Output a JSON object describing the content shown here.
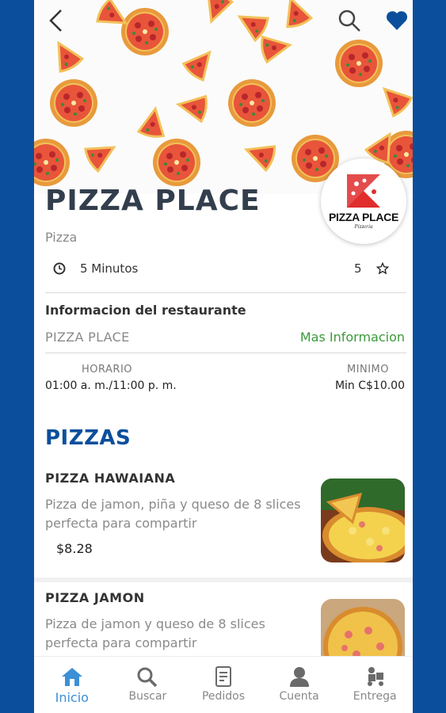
{
  "restaurant": {
    "name": "PIZZA PLACE",
    "category": "Pizza",
    "delivery_time": "5 Minutos",
    "rating": "5",
    "logo_text": "PIZZA PLACE",
    "logo_tagline": "Pizzeria"
  },
  "info": {
    "title": "Informacion del restaurante",
    "name": "PIZZA PLACE",
    "more_link": "Mas Informacion",
    "schedule_label": "HORARIO",
    "schedule_value": "01:00 a. m./11:00 p. m.",
    "minimum_label": "MINIMO",
    "minimum_value": "Min C$10.00"
  },
  "menu": {
    "section_title": "PIZZAS",
    "items": [
      {
        "name": "PIZZA HAWAIANA",
        "description": "Pizza de jamon, piña y queso de 8 slices perfecta para compartir",
        "price": "$8.28"
      },
      {
        "name": "PIZZA JAMON",
        "description": "Pizza de jamon y queso de 8 slices perfecta para compartir"
      }
    ]
  },
  "nav": {
    "items": [
      {
        "label": "Inicio",
        "icon": "home-icon",
        "active": true
      },
      {
        "label": "Buscar",
        "icon": "search-icon"
      },
      {
        "label": "Pedidos",
        "icon": "orders-icon"
      },
      {
        "label": "Cuenta",
        "icon": "account-icon"
      },
      {
        "label": "Entrega",
        "icon": "delivery-icon"
      }
    ]
  },
  "colors": {
    "brand_blue": "#0b4f9c",
    "accent_green": "#3a9a3a",
    "active_nav": "#3d8fd6"
  }
}
